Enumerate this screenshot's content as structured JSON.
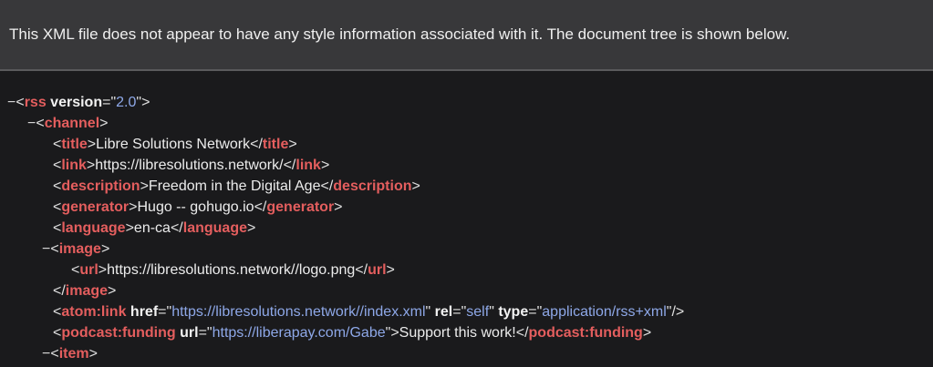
{
  "banner": {
    "text": "This XML file does not appear to have any style information associated with it. The document tree is shown below."
  },
  "tree": {
    "fold_symbol": "−",
    "rss": {
      "tag": "rss",
      "attr_version": "version",
      "version": "2.0"
    },
    "channel": {
      "tag": "channel"
    },
    "title": {
      "tag": "title",
      "text": "Libre Solutions Network"
    },
    "link": {
      "tag": "link",
      "text": "https://libresolutions.network/"
    },
    "description": {
      "tag": "description",
      "text": "Freedom in the Digital Age"
    },
    "generator": {
      "tag": "generator",
      "text": "Hugo -- gohugo.io"
    },
    "language": {
      "tag": "language",
      "text": "en-ca"
    },
    "image": {
      "tag": "image"
    },
    "url": {
      "tag": "url",
      "text": "https://libresolutions.network//logo.png"
    },
    "atom_link": {
      "tag": "atom:link",
      "attr_href": "href",
      "href": "https://libresolutions.network//index.xml",
      "attr_rel": "rel",
      "rel": "self",
      "attr_type": "type",
      "type": "application/rss+xml"
    },
    "podcast_funding": {
      "tag": "podcast:funding",
      "attr_url": "url",
      "url": "https://liberapay.com/Gabe",
      "text": "Support this work!"
    },
    "item": {
      "tag": "item"
    }
  },
  "colors": {
    "tag": "#e45e5e",
    "attr_value": "#8ea8e8",
    "banner_bg": "#38383a",
    "page_bg": "#1a1a1c"
  }
}
